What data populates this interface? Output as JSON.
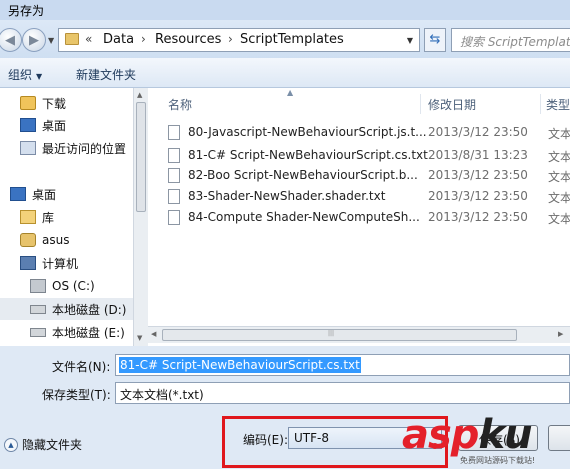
{
  "window": {
    "title": "另存为"
  },
  "address": {
    "crumbs": [
      "Data",
      "Resources",
      "ScriptTemplates"
    ],
    "search_placeholder": "搜索 ScriptTemplates"
  },
  "toolbar": {
    "organize": "组织",
    "new_folder": "新建文件夹"
  },
  "nav": {
    "items": [
      {
        "label": "下载",
        "icon": "downloads-folder-icon"
      },
      {
        "label": "桌面",
        "icon": "desktop-icon"
      },
      {
        "label": "最近访问的位置",
        "icon": "recent-places-icon"
      },
      {
        "label": "桌面",
        "icon": "desktop-icon"
      },
      {
        "label": "库",
        "icon": "library-icon"
      },
      {
        "label": "asus",
        "icon": "user-folder-icon"
      },
      {
        "label": "计算机",
        "icon": "computer-icon"
      },
      {
        "label": "OS (C:)",
        "icon": "os-drive-icon"
      },
      {
        "label": "本地磁盘 (D:)",
        "icon": "local-disk-icon"
      },
      {
        "label": "本地磁盘 (E:)",
        "icon": "local-disk-icon"
      }
    ]
  },
  "filelist": {
    "columns": {
      "name": "名称",
      "date": "修改日期",
      "type": "类型"
    },
    "rows": [
      {
        "name": "80-Javascript-NewBehaviourScript.js.t...",
        "date": "2013/3/12 23:50",
        "type": "文本"
      },
      {
        "name": "81-C# Script-NewBehaviourScript.cs.txt",
        "date": "2013/8/31 13:23",
        "type": "文本"
      },
      {
        "name": "82-Boo Script-NewBehaviourScript.b...",
        "date": "2013/3/12 23:50",
        "type": "文本"
      },
      {
        "name": "83-Shader-NewShader.shader.txt",
        "date": "2013/3/12 23:50",
        "type": "文本"
      },
      {
        "name": "84-Compute Shader-NewComputeSh...",
        "date": "2013/3/12 23:50",
        "type": "文本"
      }
    ]
  },
  "form": {
    "filename_label": "文件名(N):",
    "filename_value": "81-C# Script-NewBehaviourScript.cs.txt",
    "savetype_label": "保存类型(T):",
    "savetype_value": "文本文档(*.txt)",
    "hide_folders": "隐藏文件夹",
    "encoding_label": "编码(E):",
    "encoding_value": "UTF-8",
    "save_label": "保存(S)"
  },
  "watermark": {
    "brand_red": "asp",
    "brand_dark": "ku",
    "tagline": "免费网站源码下载站!"
  },
  "colors": {
    "highlight": "#3399ff",
    "annotation_red": "#e0171c",
    "window_bg": "#dfe9f5"
  }
}
